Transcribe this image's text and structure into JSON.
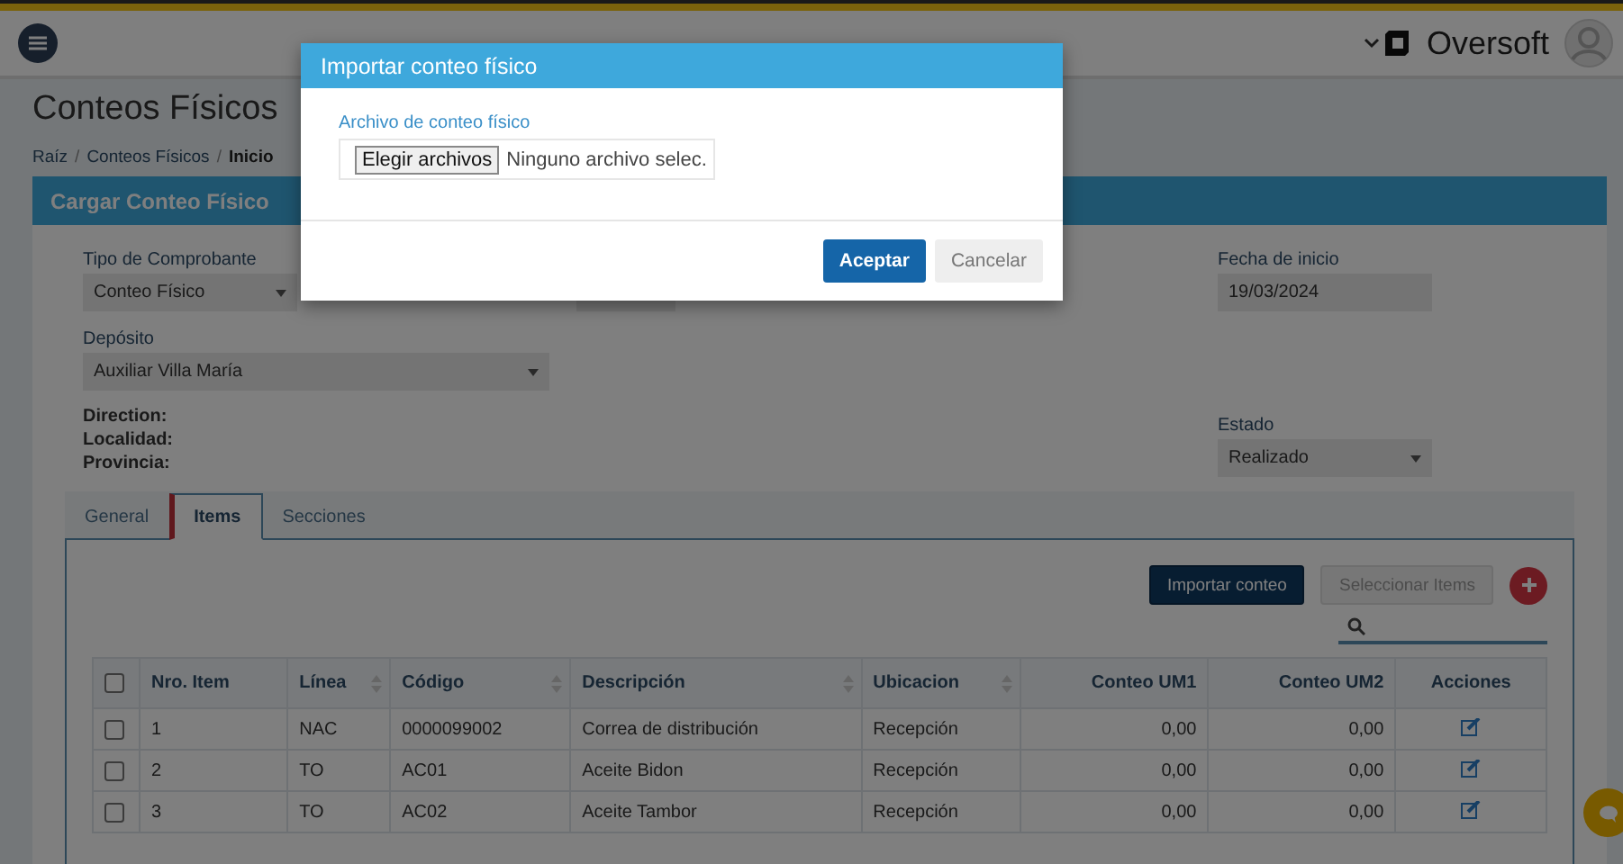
{
  "header": {
    "brand": "Oversoft"
  },
  "page": {
    "title": "Conteos Físicos",
    "separator": "/",
    "breadcrumb": [
      {
        "label": "Raíz",
        "current": false
      },
      {
        "label": "Conteos Físicos",
        "current": false
      },
      {
        "label": "Inicio",
        "current": true
      }
    ]
  },
  "panel": {
    "title": "Cargar Conteo Físico"
  },
  "form": {
    "tipo": {
      "label": "Tipo de Comprobante",
      "value": "Conteo Físico"
    },
    "fecha": {
      "label": "Fecha de inicio",
      "value": "19/03/2024"
    },
    "deposito": {
      "label": "Depósito",
      "value": "Auxiliar Villa María"
    },
    "info": [
      "Direction:",
      "Localidad:",
      "Provincia:"
    ],
    "estado": {
      "label": "Estado",
      "value": "Realizado"
    }
  },
  "tabs": [
    {
      "label": "General",
      "selected": false
    },
    {
      "label": "Items",
      "selected": true
    },
    {
      "label": "Secciones",
      "selected": false
    }
  ],
  "toolbar": {
    "import": "Importar conteo",
    "select": "Seleccionar Items"
  },
  "table": {
    "header_checked": false,
    "columns": [
      {
        "label": "Nro. Item",
        "sortable": false,
        "kind": "text"
      },
      {
        "label": "Línea",
        "sortable": true,
        "kind": "text"
      },
      {
        "label": "Código",
        "sortable": true,
        "kind": "text"
      },
      {
        "label": "Descripción",
        "sortable": true,
        "kind": "text"
      },
      {
        "label": "Ubicacion",
        "sortable": true,
        "kind": "text"
      },
      {
        "label": "Conteo UM1",
        "sortable": false,
        "kind": "number"
      },
      {
        "label": "Conteo UM2",
        "sortable": false,
        "kind": "number"
      },
      {
        "label": "Acciones",
        "sortable": false,
        "kind": "actions"
      }
    ],
    "rows": [
      {
        "checked": false,
        "cells": [
          "1",
          "NAC",
          "0000099002",
          "Correa de distribución",
          "Recepción",
          "0,00",
          "0,00"
        ]
      },
      {
        "checked": false,
        "cells": [
          "2",
          "TO",
          "AC01",
          "Aceite Bidon",
          "Recepción",
          "0,00",
          "0,00"
        ]
      },
      {
        "checked": false,
        "cells": [
          "3",
          "TO",
          "AC02",
          "Aceite Tambor",
          "Recepción",
          "0,00",
          "0,00"
        ]
      }
    ]
  },
  "modal": {
    "title": "Importar conteo físico",
    "label": "Archivo de conteo físico",
    "file_button": "Elegir archivos",
    "file_status": "Ninguno archivo selec.",
    "buttons": [
      {
        "kind": "primary",
        "label": "Aceptar"
      },
      {
        "kind": "secondary",
        "label": "Cancelar"
      }
    ]
  }
}
